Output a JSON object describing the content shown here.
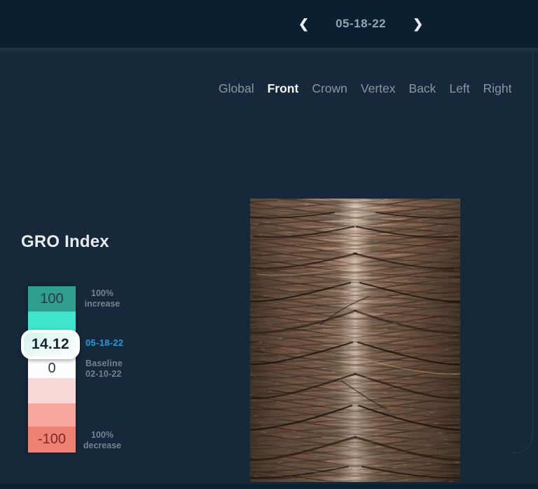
{
  "topbar": {
    "date": "05-18-22",
    "prev_icon": "❮",
    "next_icon": "❯"
  },
  "tabs": {
    "active": "Front",
    "items": [
      {
        "label": "Global"
      },
      {
        "label": "Front"
      },
      {
        "label": "Crown"
      },
      {
        "label": "Vertex"
      },
      {
        "label": "Back"
      },
      {
        "label": "Left"
      },
      {
        "label": "Right"
      }
    ]
  },
  "panel": {
    "title": "GRO Index"
  },
  "scale": {
    "segments": [
      {
        "value": "100",
        "color": "#2F9E8F"
      },
      {
        "value": "",
        "color": "#3FE5CD"
      },
      {
        "value": "0",
        "color": "#FDFDFD"
      },
      {
        "value": "",
        "color": "#F8D9D7"
      },
      {
        "value": "",
        "color": "#F5A79E"
      },
      {
        "value": "-100",
        "color": "#EE8173"
      }
    ],
    "badge": {
      "value": "14.12",
      "date": "05-18-22"
    },
    "labels": {
      "increase_line1": "100%",
      "increase_line2": "increase",
      "baseline_line1": "Baseline",
      "baseline_line2": "02-10-22",
      "decrease_line1": "100%",
      "decrease_line2": "decrease"
    }
  },
  "photo": {
    "name": "scalp-closeup-photo"
  },
  "colors": {
    "accent_blue": "#1D9CE2",
    "topbar_bg": "#0A1F30",
    "content_bg": "#15293A",
    "badge_border": "#FFFFFF"
  }
}
